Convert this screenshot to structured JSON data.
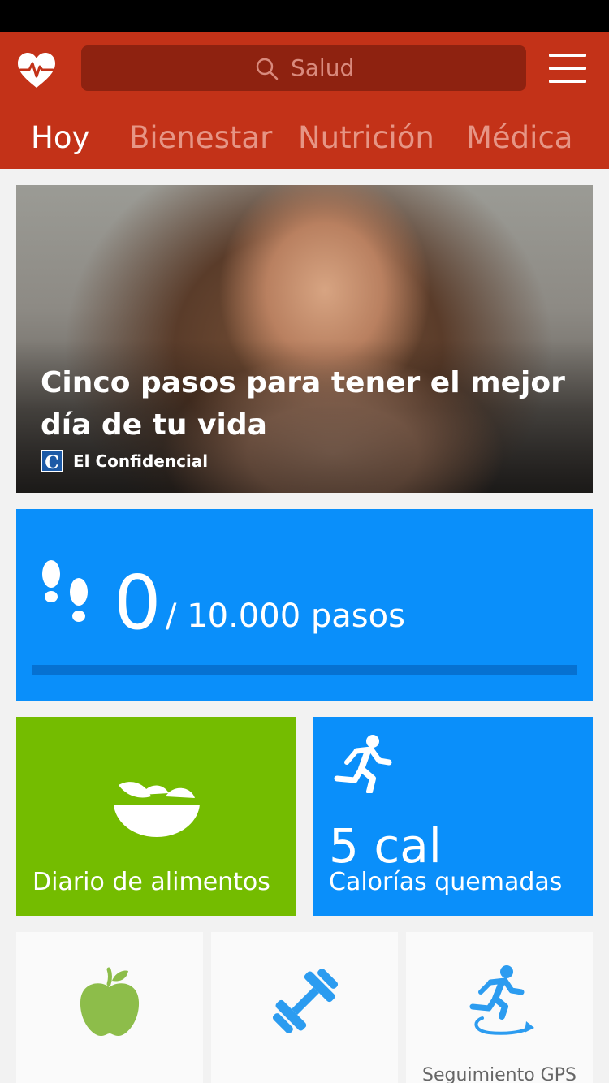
{
  "header": {
    "search_placeholder": "Salud",
    "tabs": [
      {
        "label": "Hoy",
        "active": true
      },
      {
        "label": "Bienestar",
        "active": false
      },
      {
        "label": "Nutrición",
        "active": false
      },
      {
        "label": "Médica",
        "active": false
      }
    ],
    "icons": {
      "logo": "heart-pulse-icon",
      "search": "search-icon",
      "menu": "hamburger-menu-icon"
    },
    "color": "#c33218"
  },
  "hero": {
    "title": "Cinco pasos para tener el mejor día de tu vida",
    "source_logo_letter": "C",
    "source": "El Confidencial"
  },
  "steps": {
    "current": "0",
    "goal_text": "/ 10.000 pasos",
    "progress_fraction": 0,
    "icon": "footprints-icon",
    "color": "#0a8ffa"
  },
  "tiles": {
    "food": {
      "label": "Diario de alimentos",
      "icon": "salad-bowl-icon",
      "color": "#74bc00"
    },
    "calories": {
      "value": "5 cal",
      "label": "Calorías quemadas",
      "icon": "running-icon",
      "color": "#0a8ffa"
    }
  },
  "shortcuts": [
    {
      "icon": "apple-icon",
      "label": ""
    },
    {
      "icon": "dumbbell-icon",
      "label": ""
    },
    {
      "icon": "gps-running-icon",
      "label": "Seguimiento GPS"
    }
  ]
}
